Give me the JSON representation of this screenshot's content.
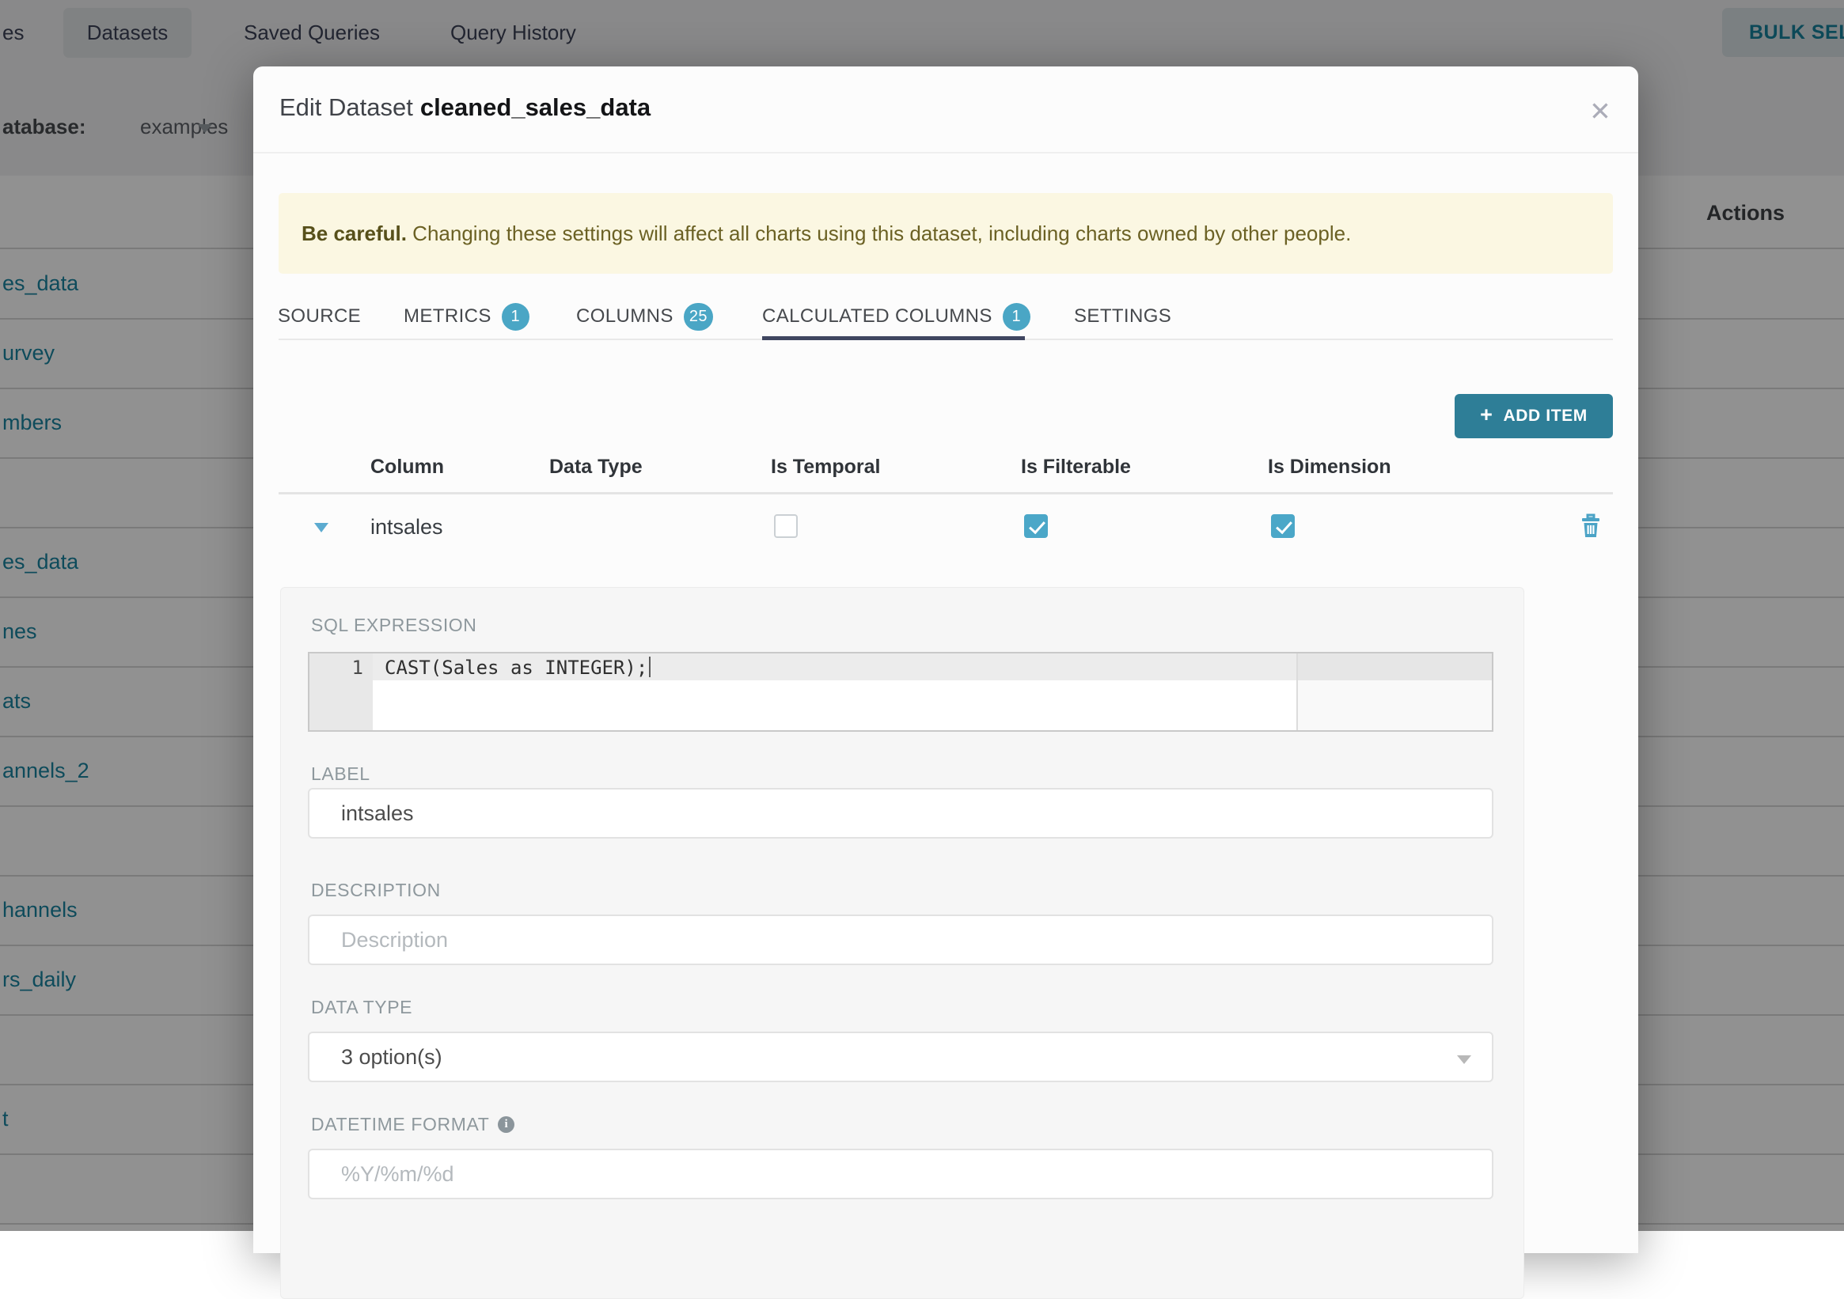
{
  "background": {
    "nav": {
      "first_tab_fragment": "es",
      "active_tab": "Datasets",
      "tab_saved_queries": "Saved Queries",
      "tab_query_history": "Query History",
      "bulk_select_label": "BULK SELECT"
    },
    "filter": {
      "database_label_fragment": "atabase:",
      "database_value": "examples"
    },
    "table": {
      "actions_header": "Actions",
      "row_fragments": [
        "es_data",
        "urvey",
        "mbers",
        "",
        "es_data",
        "nes",
        "ats",
        "annels_2",
        "",
        "hannels",
        "rs_daily",
        "",
        "t",
        ""
      ]
    }
  },
  "modal": {
    "title_prefix": "Edit Dataset",
    "title_name": "cleaned_sales_data",
    "close_glyph": "✕",
    "warning": {
      "bold": "Be careful.",
      "text": " Changing these settings will affect all charts using this dataset, including charts owned by other people."
    },
    "tabs": [
      {
        "label": "SOURCE"
      },
      {
        "label": "METRICS",
        "badge": "1"
      },
      {
        "label": "COLUMNS",
        "badge": "25"
      },
      {
        "label": "CALCULATED COLUMNS",
        "badge": "1",
        "active": true
      },
      {
        "label": "SETTINGS"
      }
    ],
    "add_item_label": "ADD ITEM",
    "add_item_plus": "+",
    "columns_table": {
      "headers": [
        "Column",
        "Data Type",
        "Is Temporal",
        "Is Filterable",
        "Is Dimension"
      ],
      "row": {
        "column": "intsales",
        "is_temporal": false,
        "is_filterable": true,
        "is_dimension": true
      }
    },
    "detail_panel": {
      "sql_expression": {
        "label": "SQL EXPRESSION",
        "line_number": "1",
        "code": "CAST(Sales as INTEGER);"
      },
      "label_field": {
        "label": "LABEL",
        "value": "intsales"
      },
      "description_field": {
        "label": "DESCRIPTION",
        "placeholder": "Description"
      },
      "data_type_field": {
        "label": "DATA TYPE",
        "value": "3 option(s)"
      },
      "datetime_format_field": {
        "label": "DATETIME FORMAT",
        "placeholder": "%Y/%m/%d",
        "info_glyph": "i"
      }
    }
  },
  "colors": {
    "accent_checkbox": "#4ba7c8",
    "badge": "#4aa6c5",
    "add_item_button": "#2e7e97",
    "link_teal": "#1985a0",
    "active_tab_underline": "#3f4660",
    "warning_bg": "#fbf7e2",
    "warning_text": "#6b6124"
  }
}
